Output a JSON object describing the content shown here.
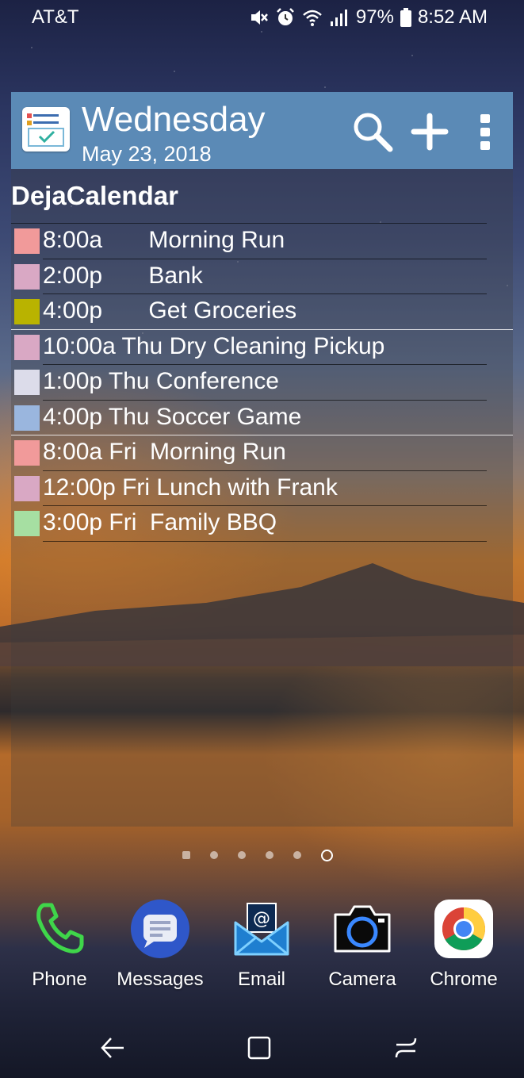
{
  "status_bar": {
    "carrier": "AT&T",
    "battery": "97%",
    "time": "8:52 AM"
  },
  "widget": {
    "day": "Wednesday",
    "date": "May 23, 2018",
    "title": "DejaCalendar",
    "header_color": "#5b8ab6",
    "events": [
      {
        "text": "8:00a       Morning Run",
        "color": "#f19a9a",
        "day_end": false
      },
      {
        "text": "2:00p       Bank",
        "color": "#d9a8c4",
        "day_end": false
      },
      {
        "text": "4:00p       Get Groceries",
        "color": "#b9b300",
        "day_end": true
      },
      {
        "text": "10:00a Thu Dry Cleaning Pickup",
        "color": "#d9a8c4",
        "day_end": false
      },
      {
        "text": "1:00p Thu Conference",
        "color": "#dcdcea",
        "day_end": false
      },
      {
        "text": "4:00p Thu Soccer Game",
        "color": "#9ab6de",
        "day_end": true
      },
      {
        "text": "8:00a Fri  Morning Run",
        "color": "#f19a9a",
        "day_end": false
      },
      {
        "text": "12:00p Fri Lunch with Frank",
        "color": "#d9a8c4",
        "day_end": false
      },
      {
        "text": "3:00p Fri  Family BBQ",
        "color": "#a6dfa2",
        "day_end": false
      }
    ]
  },
  "page_indicator": {
    "count": 6,
    "active": 5
  },
  "dock": {
    "apps": [
      {
        "label": "Phone"
      },
      {
        "label": "Messages"
      },
      {
        "label": "Email"
      },
      {
        "label": "Camera"
      },
      {
        "label": "Chrome"
      }
    ]
  }
}
